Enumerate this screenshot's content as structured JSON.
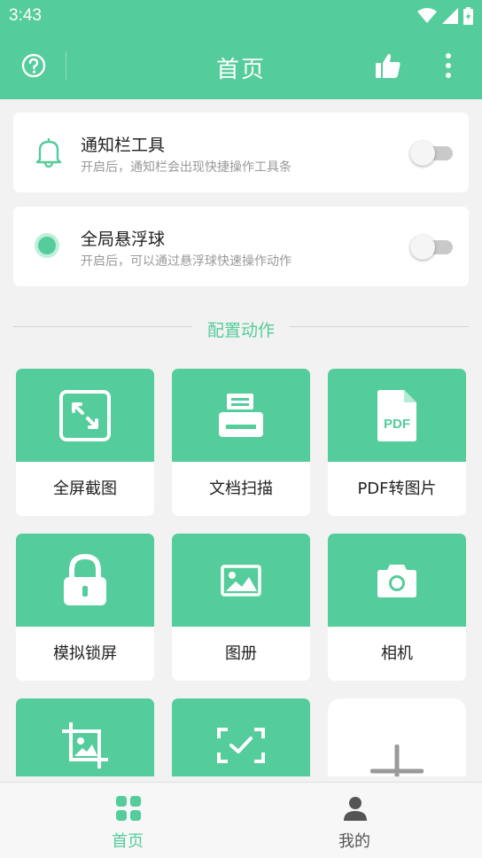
{
  "status_bar": {
    "time": "3:43"
  },
  "app_bar": {
    "title": "首页",
    "icons": [
      "help-circle-icon",
      "thumbs-up-icon",
      "more-vertical-icon"
    ]
  },
  "settings": [
    {
      "title": "通知栏工具",
      "subtitle": "开启后，通知栏会出现快捷操作工具条",
      "icon": "bell-icon",
      "enabled": false
    },
    {
      "title": "全局悬浮球",
      "subtitle": "开启后，可以通过悬浮球快速操作动作",
      "icon": "floating-ball-icon",
      "enabled": false
    }
  ],
  "section_label": "配置动作",
  "actions": [
    {
      "label": "全屏截图",
      "icon": "fullscreen-capture-icon"
    },
    {
      "label": "文档扫描",
      "icon": "scanner-icon"
    },
    {
      "label": "PDF转图片",
      "icon": "pdf-file-icon",
      "icon_text": "PDF"
    },
    {
      "label": "模拟锁屏",
      "icon": "lock-icon"
    },
    {
      "label": "图册",
      "icon": "gallery-icon"
    },
    {
      "label": "相机",
      "icon": "camera-icon"
    },
    {
      "label": "",
      "icon": "crop-image-icon"
    },
    {
      "label": "",
      "icon": "scan-check-icon"
    },
    {
      "label": "",
      "icon": "add-icon"
    }
  ],
  "bottom_nav": [
    {
      "label": "首页",
      "icon": "home-grid-icon",
      "active": true
    },
    {
      "label": "我的",
      "icon": "person-icon",
      "active": false
    }
  ],
  "colors": {
    "accent": "#55cc9b",
    "background": "#f2f2f2",
    "inactive": "#555555"
  }
}
